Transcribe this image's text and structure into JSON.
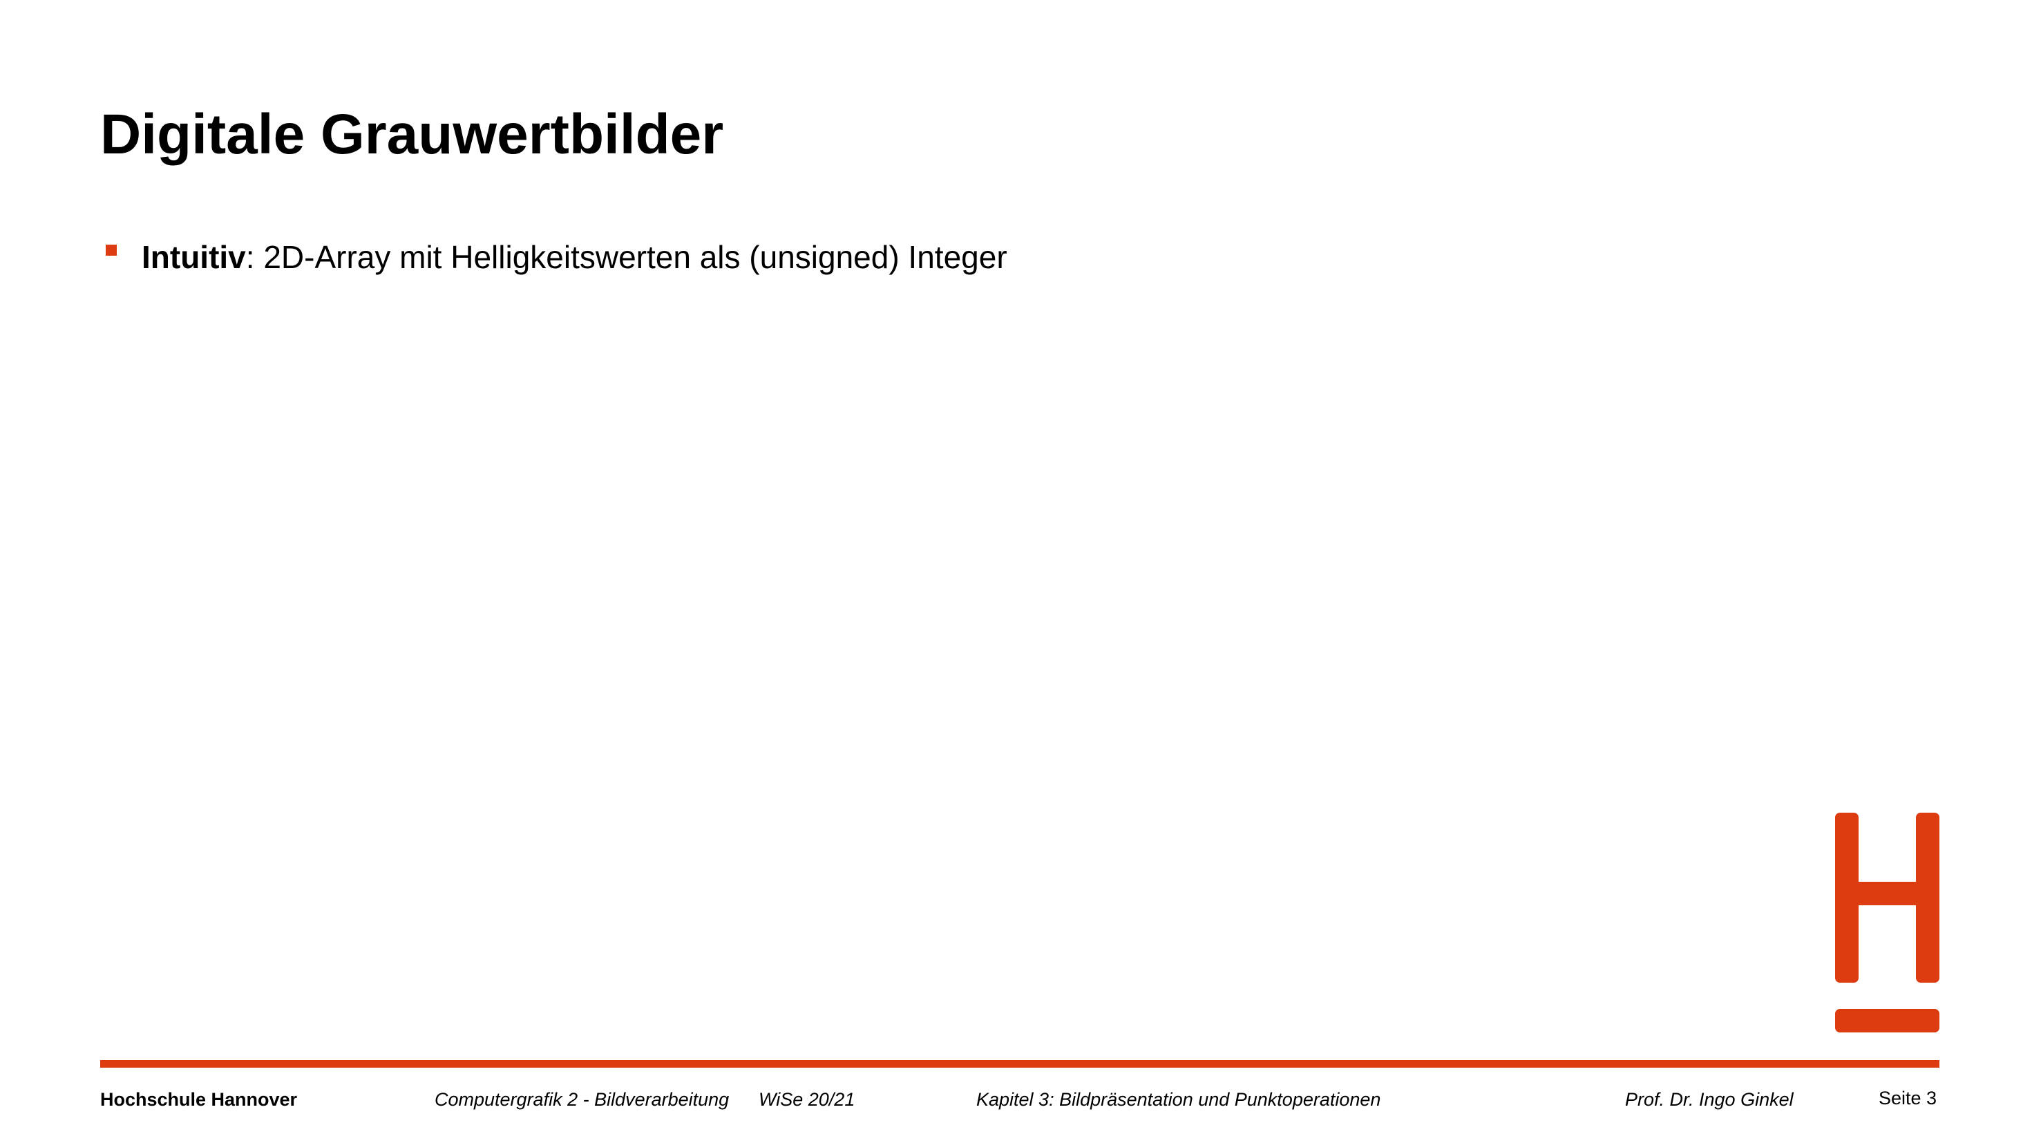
{
  "slide": {
    "title": "Digitale Grauwertbilder",
    "bullets": [
      {
        "term": "Intuitiv",
        "text": ": 2D-Array mit Helligkeitswerten als (unsigned) Integer"
      }
    ]
  },
  "footer": {
    "organization": "Hochschule Hannover",
    "course": "Computergrafik 2 - Bildverarbeitung",
    "term": "WiSe 20/21",
    "chapter": "Kapitel 3: Bildpräsentation und Punktoperationen",
    "author": "Prof. Dr. Ingo Ginkel",
    "page": "Seite 3"
  },
  "colors": {
    "accent": "#dc3c0f",
    "text": "#000000",
    "background": "#ffffff"
  },
  "icons": {
    "logo": "hochschule-hannover-logo"
  }
}
